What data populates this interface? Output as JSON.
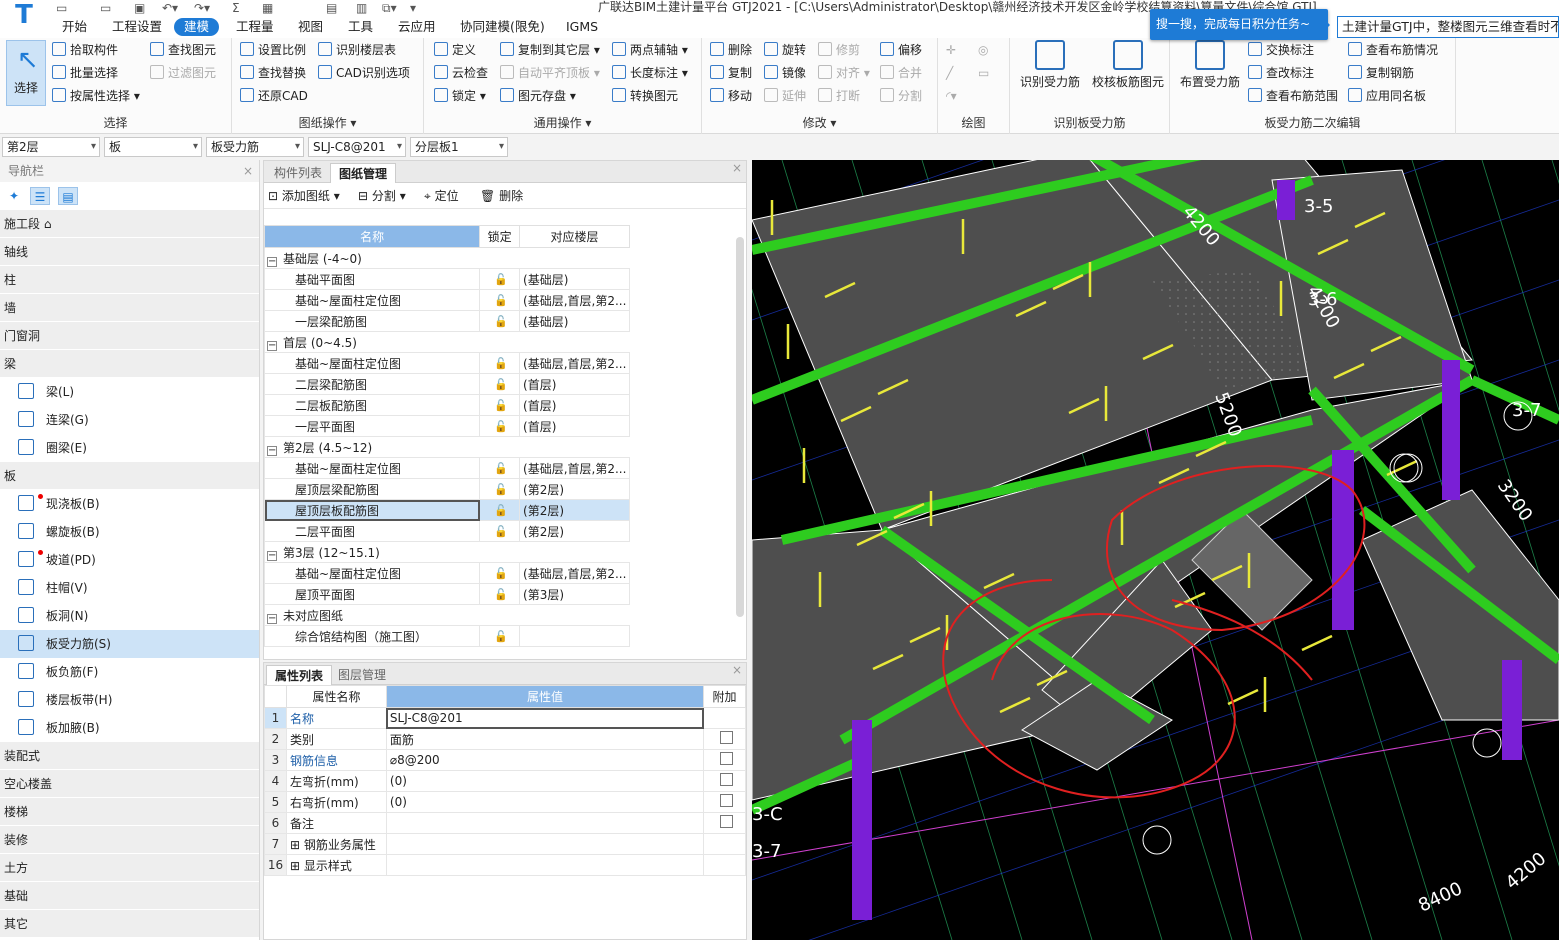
{
  "window": {
    "title": "广联达BIM土建计量平台 GTJ2021 - [C:\\Users\\Administrator\\Desktop\\赣州经济技术开发区金岭学校结算资料\\算量文件\\综合馆.GTJ]"
  },
  "menu": {
    "tabs": [
      "开始",
      "工程设置",
      "建模",
      "工程量",
      "视图",
      "工具",
      "云应用",
      "协同建模(限免)",
      "IGMS"
    ],
    "active": "建模"
  },
  "popup": {
    "search_tip": "搜一搜，完成每日积分任务~",
    "question": "土建计量GTJ中，整楼图元三维查看时不"
  },
  "ribbon": {
    "select": {
      "big": "选择",
      "items": [
        "拾取构件",
        "批量选择",
        "按属性选择",
        "查找图元",
        "过滤图元"
      ],
      "label": "选择"
    },
    "drawing_ops": {
      "items": [
        "设置比例",
        "识别楼层表",
        "查找替换",
        "CAD识别选项",
        "还原CAD"
      ],
      "label": "图纸操作"
    },
    "common_ops": {
      "items": [
        "定义",
        "复制到其它层",
        "两点辅轴",
        "云检查",
        "自动平齐顶板",
        "长度标注",
        "锁定",
        "图元存盘",
        "转换图元"
      ],
      "label": "通用操作"
    },
    "modify": {
      "items": [
        "删除",
        "旋转",
        "修剪",
        "偏移",
        "复制",
        "镜像",
        "对齐",
        "合并",
        "移动",
        "延伸",
        "打断",
        "分割"
      ],
      "label": "修改"
    },
    "draw": {
      "label": "绘图"
    },
    "recognize": {
      "items": [
        "识别受力筋",
        "校核板筋图元"
      ],
      "label": "识别板受力筋"
    },
    "secondary": {
      "big": "布置受力筋",
      "items": [
        "交换标注",
        "查看布筋情况",
        "查改标注",
        "复制钢筋",
        "查看布筋范围",
        "应用同名板"
      ],
      "label": "板受力筋二次编辑"
    }
  },
  "filters": [
    "第2层",
    "板",
    "板受力筋",
    "SLJ-C8@201",
    "分层板1"
  ],
  "nav": {
    "header": "导航栏",
    "categories": [
      {
        "name": "施工段",
        "items": []
      },
      {
        "name": "轴线",
        "items": []
      },
      {
        "name": "柱",
        "items": []
      },
      {
        "name": "墙",
        "items": []
      },
      {
        "name": "门窗洞",
        "items": []
      },
      {
        "name": "梁",
        "items": [
          "梁(L)",
          "连梁(G)",
          "圈梁(E)"
        ]
      },
      {
        "name": "板",
        "items": [
          "现浇板(B)",
          "螺旋板(B)",
          "坡道(PD)",
          "柱帽(V)",
          "板洞(N)",
          "板受力筋(S)",
          "板负筋(F)",
          "楼层板带(H)",
          "板加腋(B)"
        ]
      },
      {
        "name": "装配式",
        "items": []
      },
      {
        "name": "空心楼盖",
        "items": []
      },
      {
        "name": "楼梯",
        "items": []
      },
      {
        "name": "装修",
        "items": []
      },
      {
        "name": "土方",
        "items": []
      },
      {
        "name": "基础",
        "items": []
      },
      {
        "name": "其它",
        "items": []
      }
    ],
    "selected": "板受力筋(S)"
  },
  "drawing_panel": {
    "tabs": [
      "构件列表",
      "图纸管理"
    ],
    "active_tab": "图纸管理",
    "tools": [
      "添加图纸",
      "分割",
      "定位",
      "删除"
    ],
    "columns": [
      "名称",
      "锁定",
      "对应楼层"
    ],
    "groups": [
      {
        "name": "基础层 (-4~0)",
        "rows": [
          [
            "基础平面图",
            "(基础层)"
          ],
          [
            "基础~屋面柱定位图",
            "(基础层,首层,第2..."
          ],
          [
            "一层梁配筋图",
            "(基础层)"
          ]
        ]
      },
      {
        "name": "首层 (0~4.5)",
        "rows": [
          [
            "基础~屋面柱定位图",
            "(基础层,首层,第2..."
          ],
          [
            "二层梁配筋图",
            "(首层)"
          ],
          [
            "二层板配筋图",
            "(首层)"
          ],
          [
            "一层平面图",
            "(首层)"
          ]
        ]
      },
      {
        "name": "第2层 (4.5~12)",
        "rows": [
          [
            "基础~屋面柱定位图",
            "(基础层,首层,第2..."
          ],
          [
            "屋顶层梁配筋图",
            "(第2层)"
          ],
          [
            "屋顶层板配筋图",
            "(第2层)"
          ],
          [
            "二层平面图",
            "(第2层)"
          ]
        ]
      },
      {
        "name": "第3层 (12~15.1)",
        "rows": [
          [
            "基础~屋面柱定位图",
            "(基础层,首层,第2..."
          ],
          [
            "屋顶平面图",
            "(第3层)"
          ]
        ]
      },
      {
        "name": "未对应图纸",
        "rows": [
          [
            "综合馆结构图（施工图）",
            ""
          ]
        ]
      }
    ],
    "selected_row": "屋顶层板配筋图"
  },
  "property_panel": {
    "tabs": [
      "属性列表",
      "图层管理"
    ],
    "active_tab": "属性列表",
    "columns": [
      "属性名称",
      "属性值",
      "附加"
    ],
    "rows": [
      {
        "num": "1",
        "name": "名称",
        "value": "SLJ-C8@201",
        "blue": true,
        "check": false
      },
      {
        "num": "2",
        "name": "类别",
        "value": "面筋",
        "blue": false,
        "check": true
      },
      {
        "num": "3",
        "name": "钢筋信息",
        "value": "⌀8@200",
        "blue": true,
        "check": true
      },
      {
        "num": "4",
        "name": "左弯折(mm)",
        "value": "(0)",
        "blue": false,
        "check": true
      },
      {
        "num": "5",
        "name": "右弯折(mm)",
        "value": "(0)",
        "blue": false,
        "check": true
      },
      {
        "num": "6",
        "name": "备注",
        "value": "",
        "blue": false,
        "check": true
      },
      {
        "num": "7",
        "name": "钢筋业务属性",
        "value": "",
        "blue": false,
        "check": false,
        "expand": true
      },
      {
        "num": "16",
        "name": "显示样式",
        "value": "",
        "blue": false,
        "check": false,
        "expand": true
      }
    ]
  },
  "viewport": {
    "labels": [
      "3-5",
      "4200",
      "3-6",
      "4200",
      "5200",
      "3-7",
      "3200",
      "3-C",
      "3-7",
      "8400",
      "4200"
    ],
    "colors": {
      "beam": "#2ecc1f",
      "slab": "#4e4e4e",
      "column": "#7a1fd6",
      "rebar": "#e8e83a",
      "annotation": "#e02020",
      "grid": "#1e3cd6",
      "axis": "#2fd67a"
    }
  }
}
